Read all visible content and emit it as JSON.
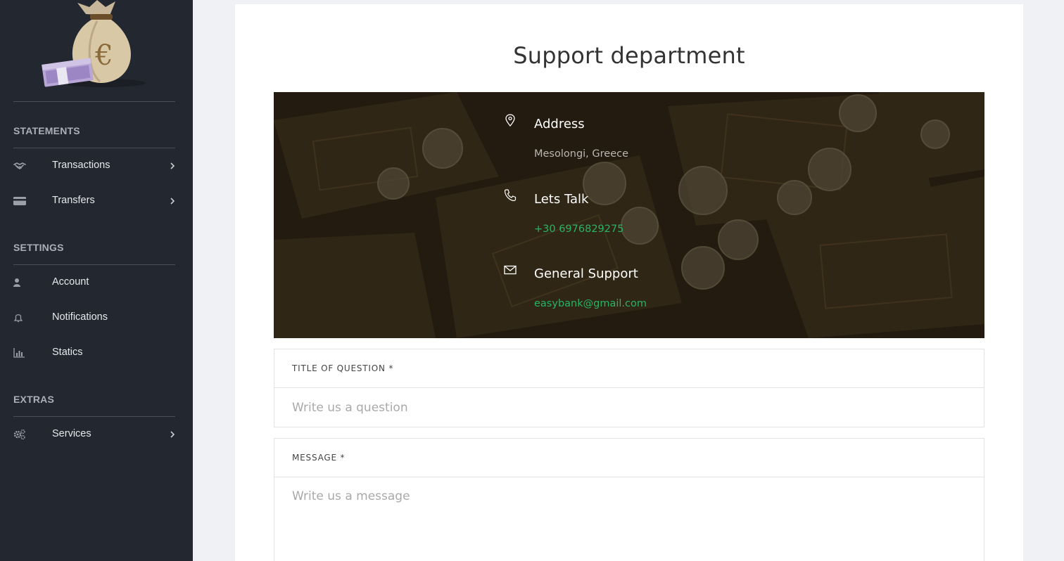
{
  "sidebar": {
    "sections": [
      {
        "title": "STATEMENTS",
        "items": [
          {
            "label": "Transactions",
            "icon": "handshake-icon",
            "has_submenu": true
          },
          {
            "label": "Transfers",
            "icon": "credit-card-icon",
            "has_submenu": true
          }
        ]
      },
      {
        "title": "SETTINGS",
        "items": [
          {
            "label": "Account",
            "icon": "user-icon",
            "has_submenu": false
          },
          {
            "label": "Notifications",
            "icon": "bell-icon",
            "has_submenu": false
          },
          {
            "label": "Statics",
            "icon": "bar-chart-icon",
            "has_submenu": false
          }
        ]
      },
      {
        "title": "EXTRAS",
        "items": [
          {
            "label": "Services",
            "icon": "gears-icon",
            "has_submenu": true
          }
        ]
      }
    ]
  },
  "main": {
    "title": "Support department",
    "contact": {
      "address_title": "Address",
      "address_value": "Mesolongi, Greece",
      "phone_title": "Lets Talk",
      "phone_value": "+30 6976829275",
      "support_title": "General Support",
      "support_value": "easybank@gmail.com"
    },
    "form": {
      "question_label": "TITLE OF QUESTION *",
      "question_placeholder": "Write us a question",
      "message_label": "MESSAGE *",
      "message_placeholder": "Write us a message"
    }
  },
  "colors": {
    "sidebar_bg": "#23272f",
    "page_bg": "#f0f1f5",
    "accent_green": "#28b463"
  }
}
